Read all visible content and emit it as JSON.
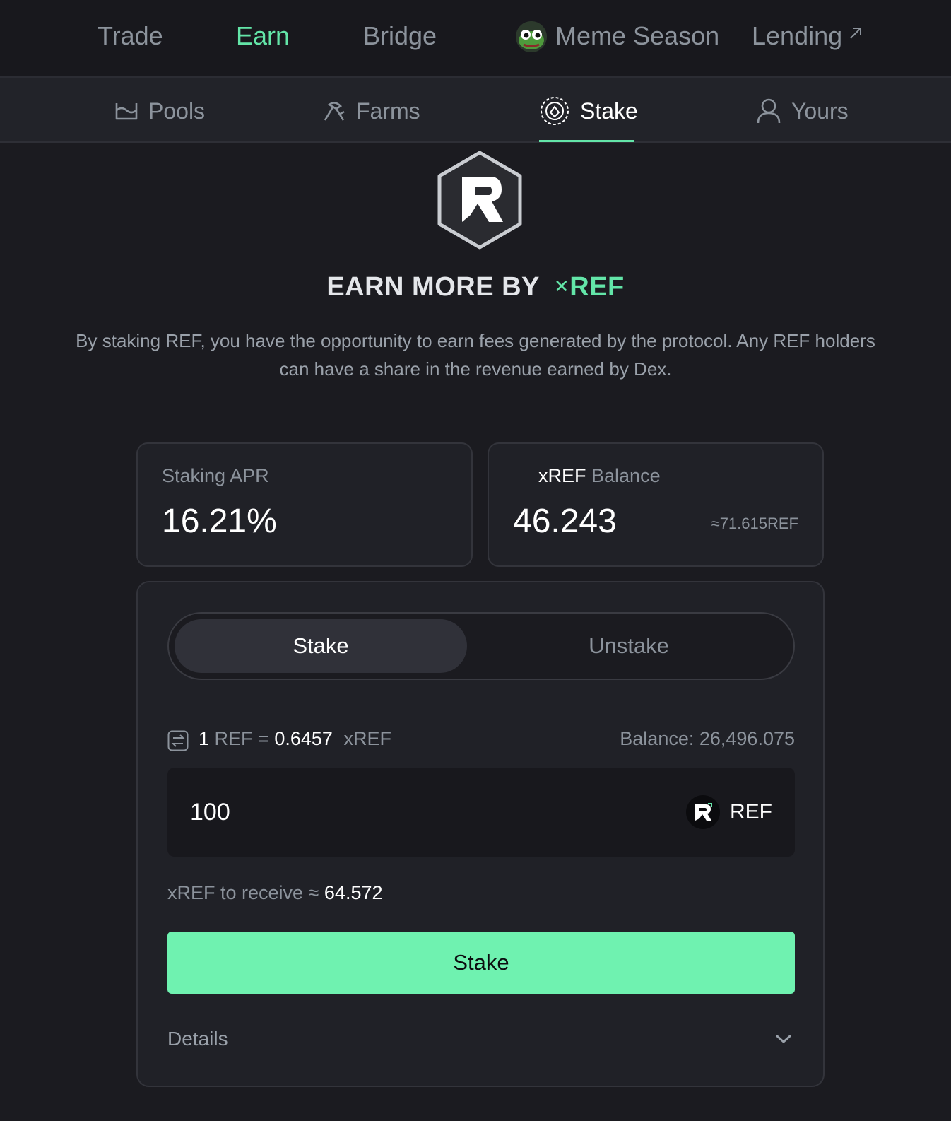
{
  "top_nav": {
    "items": [
      {
        "label": "Trade",
        "active": false
      },
      {
        "label": "Earn",
        "active": true
      },
      {
        "label": "Bridge",
        "active": false
      },
      {
        "label": "Meme Season",
        "active": false,
        "icon": "frog-avatar-icon"
      },
      {
        "label": "Lending",
        "active": false,
        "icon": "external-arrow-icon"
      }
    ]
  },
  "sub_nav": {
    "items": [
      {
        "label": "Pools",
        "icon": "pools-icon",
        "active": false
      },
      {
        "label": "Farms",
        "icon": "farms-icon",
        "active": false
      },
      {
        "label": "Stake",
        "icon": "stake-icon",
        "active": true
      },
      {
        "label": "Yours",
        "icon": "user-icon",
        "active": false
      }
    ]
  },
  "hero": {
    "title_prefix": "EARN MORE BY",
    "title_x": "✕",
    "title_token": "REF",
    "description": "By staking REF, you have the opportunity to earn fees generated by the protocol. Any REF holders can have a share in the revenue earned by Dex."
  },
  "stats": {
    "apr_label": "Staking APR",
    "apr_value": "16.21%",
    "balance_token": "xREF",
    "balance_label": "Balance",
    "balance_value": "46.243",
    "balance_approx": "≈71.615REF"
  },
  "form": {
    "tabs": {
      "stake": "Stake",
      "unstake": "Unstake",
      "active": "stake"
    },
    "rate": {
      "one": "1",
      "ref": "REF",
      "eq": "=",
      "value": "0.6457",
      "xref": "xREF"
    },
    "balance_text": "Balance: 26,496.075",
    "amount": "100",
    "token": "REF",
    "receive_label": "xREF to receive ≈",
    "receive_value": "64.572",
    "submit": "Stake",
    "details": "Details"
  },
  "colors": {
    "accent": "#63e5a8",
    "button": "#6ff2b0",
    "background": "#1b1b20",
    "card": "#202127"
  }
}
